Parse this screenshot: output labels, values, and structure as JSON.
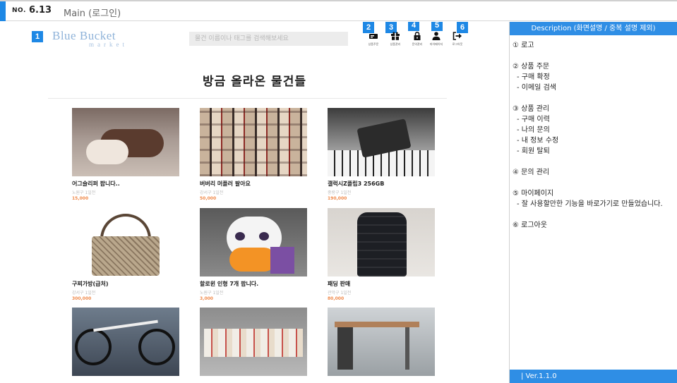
{
  "header": {
    "no_label": "NO.",
    "number": "6.13",
    "title": "Main (로그인)"
  },
  "badges": [
    "1",
    "2",
    "3",
    "4",
    "5",
    "6"
  ],
  "logo": {
    "main": "Blue Bucket",
    "sub": "market"
  },
  "search": {
    "placeholder": "물건 이름이나 태그를 검색해보세요"
  },
  "nav": [
    {
      "icon": "order-icon",
      "label": "상품주문"
    },
    {
      "icon": "gift-icon",
      "label": "상품관리"
    },
    {
      "icon": "lock-icon",
      "label": "문의관리"
    },
    {
      "icon": "user-icon",
      "label": "마이페이지"
    },
    {
      "icon": "logout-icon",
      "label": "로그아웃"
    }
  ],
  "heading": "방금 올라온 물건들",
  "products": [
    {
      "name": "어그슬리퍼 팝니다..",
      "loc": "노원구 1일전",
      "price": "15,000"
    },
    {
      "name": "버버리 머플러 팔아요",
      "loc": "강서구 1일전",
      "price": "50,000"
    },
    {
      "name": "갤럭시Z플립3 256GB",
      "loc": "중랑구 1일전",
      "price": "190,000"
    },
    {
      "name": "구찌가방(급처)",
      "loc": "강서구 1일전",
      "price": "300,000"
    },
    {
      "name": "할로윈 인형 7개 팝니다.",
      "loc": "노원구 1일전",
      "price": "3,000"
    },
    {
      "name": "패딩 판매",
      "loc": "관악구 1일전",
      "price": "80,000"
    },
    {
      "name": "",
      "loc": "",
      "price": ""
    },
    {
      "name": "",
      "loc": "",
      "price": ""
    },
    {
      "name": "",
      "loc": "",
      "price": ""
    }
  ],
  "description": {
    "title": "Description (화면설명 / 중복 설명 제외)",
    "items": [
      {
        "title": "① 로고",
        "subs": []
      },
      {
        "title": "② 상품 주문",
        "subs": [
          "- 구매 확정",
          "- 이메일 검색"
        ]
      },
      {
        "title": "③ 상품 관리",
        "subs": [
          "- 구매 이력",
          "- 나의 문의",
          "- 내 정보 수정",
          "- 회원 탈퇴"
        ]
      },
      {
        "title": "④ 문의 관리",
        "subs": []
      },
      {
        "title": "⑤ 마이페이지",
        "subs": [
          "- 잘 사용할만한 기능을 바로가기로 만들었습니다."
        ]
      },
      {
        "title": "⑥ 로그아웃",
        "subs": []
      }
    ],
    "version": "| Ver.1.1.0"
  },
  "colors": {
    "accent": "#1e88e5",
    "panel_header": "#2f8ee5",
    "price": "#f08a4b"
  }
}
